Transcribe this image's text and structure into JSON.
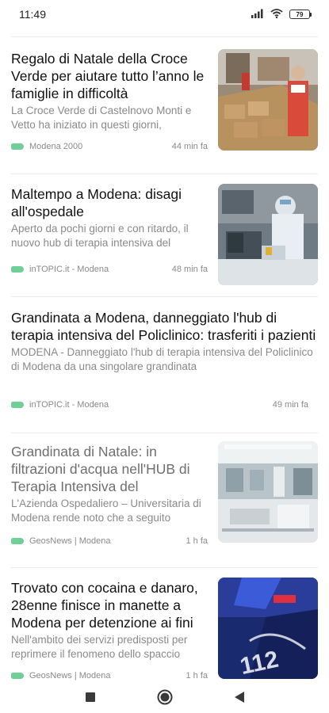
{
  "status_bar": {
    "time": "11:49",
    "battery": "79",
    "icons": [
      "signal-icon",
      "wifi-icon",
      "battery-icon"
    ]
  },
  "articles": [
    {
      "title": "Regalo di Natale della Croce Verde per aiutare tutto l’anno le famiglie in difficoltà",
      "snippet": "La Croce Verde di Castelnovo Monti e Vetto ha iniziato in questi giorni,",
      "source": "Modena 2000",
      "time": "44 min fa",
      "read": false
    },
    {
      "title": "Maltempo a Modena: disagi all'ospedale",
      "snippet": "Aperto da pochi giorni e con ritardo, il nuovo hub di terapia intensiva del",
      "source": "inTOPIC.it - Modena",
      "time": "48 min fa",
      "read": false
    },
    {
      "title": "Grandinata a Modena, danneggiato l'hub di terapia intensiva del Policlinico: trasferiti i pazienti",
      "snippet": "MODENA - Danneggiato l'hub di terapia intensiva del Policlinico di Modena da una singolare grandinata",
      "source": "inTOPIC.it - Modena",
      "time": "49 min fa",
      "read": false
    },
    {
      "title": "Grandinata di Natale: in filtrazioni d'acqua nell'HUB di Terapia Intensiva del",
      "snippet": "L'Azienda Ospedaliero – Universitaria di Modena rende noto che a seguito",
      "source": "GeosNews | Modena",
      "time": "1 h fa",
      "read": true
    },
    {
      "title": "Trovato con cocaina e danaro, 28enne finisce in manette a Modena per detenzione ai fini",
      "snippet": "Nell'ambito dei servizi predisposti per reprimere il fenomeno dello spaccio",
      "source": "GeosNews | Modena",
      "time": "1 h fa",
      "read": false
    }
  ],
  "nav_bar": {
    "buttons": [
      "recents-square-icon",
      "home-circle-icon",
      "back-triangle-icon"
    ]
  }
}
